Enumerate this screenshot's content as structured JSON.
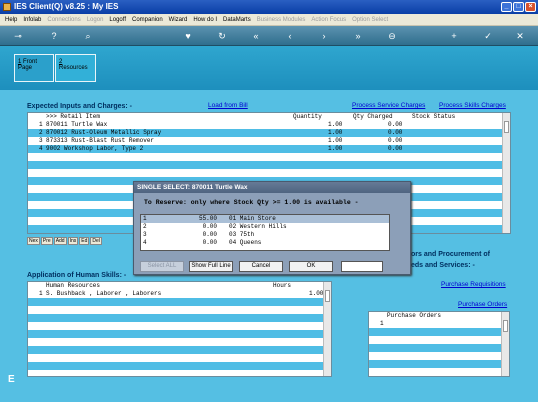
{
  "window": {
    "title": "IES Client(Q) v8.25 : My IES"
  },
  "menu": [
    {
      "label": "Help",
      "enabled": true
    },
    {
      "label": "Infolab",
      "enabled": true
    },
    {
      "label": "Connections",
      "enabled": false
    },
    {
      "label": "Logon",
      "enabled": false
    },
    {
      "label": "Logoff",
      "enabled": true
    },
    {
      "label": "Companion",
      "enabled": true
    },
    {
      "label": "Wizard",
      "enabled": true
    },
    {
      "label": "How do I",
      "enabled": true
    },
    {
      "label": "DataMarts",
      "enabled": true
    },
    {
      "label": "Business Modules",
      "enabled": false
    },
    {
      "label": "Action Focus",
      "enabled": false
    },
    {
      "label": "Option Select",
      "enabled": false
    }
  ],
  "tabs": [
    {
      "num": "1",
      "label": " Front Page"
    },
    {
      "num": "2",
      "label": " Resources"
    }
  ],
  "inputs_section": {
    "title": "Expected Inputs and Charges: -",
    "load_link": "Load from Bill",
    "service_link": "Process Service Charges",
    "skills_link": "Process Skills Charges",
    "headers": {
      "item": ">>> Retail Item",
      "qty": "Quantity",
      "charged": "Qty Charged",
      "status": "Stock Status"
    },
    "rows": [
      {
        "n": "1",
        "item": "870011 Turtle Wax",
        "qty": "1.00",
        "charged": "0.00"
      },
      {
        "n": "2",
        "item": "870012 Rust-Oleum Metallic Spray",
        "qty": "1.00",
        "charged": "0.00"
      },
      {
        "n": "3",
        "item": "873313 Rust-Blast Rust Remover",
        "qty": "1.00",
        "charged": "0.00"
      },
      {
        "n": "4",
        "item": "9002 Workshop Labor, Type 2",
        "qty": "1.00",
        "charged": "0.00"
      }
    ]
  },
  "nav_buttons": [
    "Nex",
    "Pre",
    "Add",
    "Ins",
    "Ed",
    "Del"
  ],
  "skills_section": {
    "title": "Application of Human Skills: -",
    "headers": {
      "resource": "Human Resources",
      "hours": "Hours"
    },
    "rows": [
      {
        "n": "1",
        "resource": "S. Bushback    , Laborer      , Laborers",
        "hours": "1.00"
      }
    ]
  },
  "procurement": {
    "title_line1": "ors and Procurement of",
    "title_line2": "eds and Services: -",
    "req_link": "Purchase Requisitions",
    "po_link": "Purchase Orders",
    "header": "Purchase Orders",
    "row_num": "1"
  },
  "dialog": {
    "title": "SINGLE SELECT: 870011 Turtle Wax",
    "message": "To Reserve: only where Stock Qty >= 1.00 is available -",
    "rows": [
      {
        "n": "1",
        "qty": "55.00",
        "store": "01 Main Store"
      },
      {
        "n": "2",
        "qty": "0.00",
        "store": "02 Western Hills"
      },
      {
        "n": "3",
        "qty": "0.00",
        "store": "03 75th"
      },
      {
        "n": "4",
        "qty": "0.00",
        "store": "04 Queens"
      }
    ],
    "buttons": {
      "select_all": "Select ALL",
      "full_line": "Show Full Line",
      "cancel": "Cancel",
      "ok": "OK"
    }
  },
  "bottom_letter": "E"
}
